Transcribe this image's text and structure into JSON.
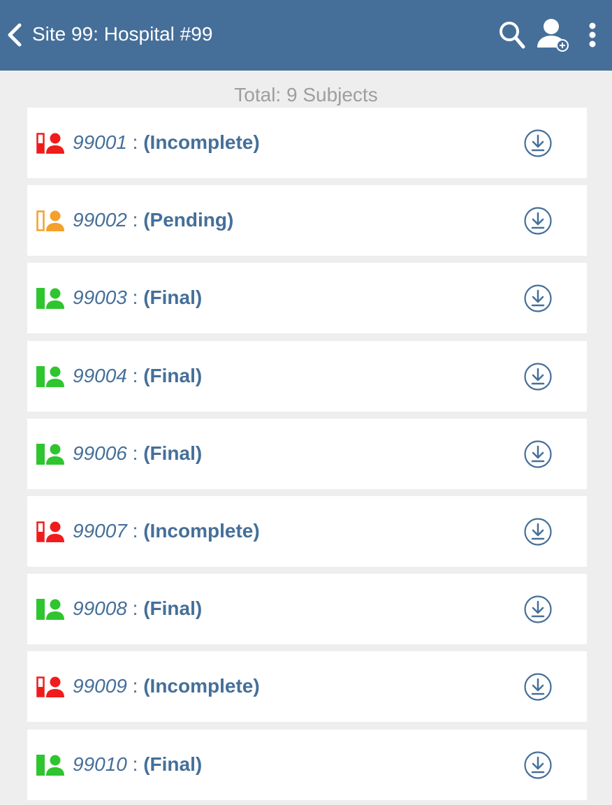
{
  "header": {
    "title": "Site 99: Hospital #99",
    "back_icon": "chevron-left-icon",
    "actions": [
      "search-icon",
      "add-user-icon",
      "more-vert-icon"
    ]
  },
  "summary": {
    "total_text": "Total: 9 Subjects"
  },
  "colors": {
    "appbar": "#456f99",
    "text_primary": "#456f99",
    "incomplete": "#f01c1c",
    "pending": "#f5a02a",
    "final": "#2ec52e"
  },
  "subjects": [
    {
      "id": "99001",
      "separator": " : ",
      "status": "(Incomplete)",
      "status_key": "incomplete"
    },
    {
      "id": "99002",
      "separator": " : ",
      "status": "(Pending)",
      "status_key": "pending"
    },
    {
      "id": "99003",
      "separator": " : ",
      "status": "(Final)",
      "status_key": "final"
    },
    {
      "id": "99004",
      "separator": " : ",
      "status": "(Final)",
      "status_key": "final"
    },
    {
      "id": "99006",
      "separator": " : ",
      "status": "(Final)",
      "status_key": "final"
    },
    {
      "id": "99007",
      "separator": " : ",
      "status": "(Incomplete)",
      "status_key": "incomplete"
    },
    {
      "id": "99008",
      "separator": " : ",
      "status": "(Final)",
      "status_key": "final"
    },
    {
      "id": "99009",
      "separator": " : ",
      "status": "(Incomplete)",
      "status_key": "incomplete"
    },
    {
      "id": "99010",
      "separator": " : ",
      "status": "(Final)",
      "status_key": "final"
    }
  ],
  "row_action_icon": "download-circle-icon"
}
